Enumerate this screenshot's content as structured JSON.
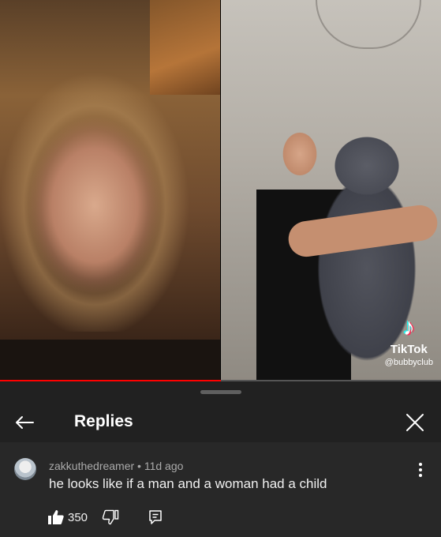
{
  "video": {
    "watermark": {
      "name": "TikTok",
      "handle": "@bubbyclub"
    },
    "progress": 0.5
  },
  "sheet": {
    "title": "Replies"
  },
  "comment": {
    "author": "zakkuthedreamer",
    "time": "11d ago",
    "meta": "zakkuthedreamer • 11d ago",
    "text": "he looks like if a man and a woman had a child",
    "likes": "350"
  },
  "colors": {
    "background": "#212121",
    "comment_bg": "#282828",
    "progress": "#ff0000",
    "secondary_text": "#aaaaaa"
  },
  "icons": [
    "back-arrow-icon",
    "close-icon",
    "more-vert-icon",
    "thumb-up-icon",
    "thumb-down-icon",
    "reply-icon",
    "tiktok-logo-icon"
  ]
}
